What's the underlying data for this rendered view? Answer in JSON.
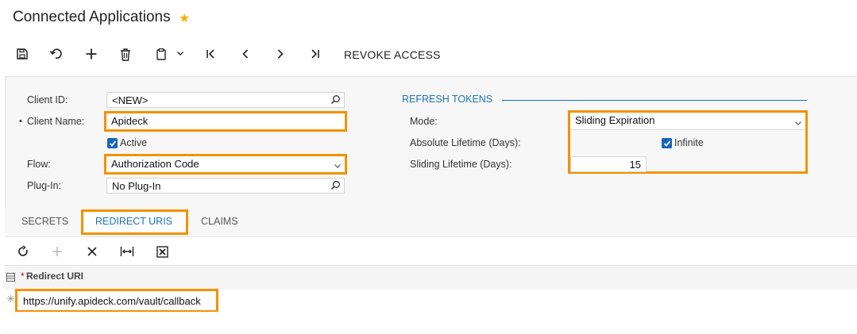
{
  "header": {
    "title": "Connected Applications",
    "star": "★"
  },
  "toolbar": {
    "icons": [
      "save-icon",
      "undo-icon",
      "add-icon",
      "delete-icon",
      "copy-paste-icon",
      "first-record-icon",
      "previous-record-icon",
      "next-record-icon",
      "last-record-icon"
    ],
    "revoke_label": "REVOKE ACCESS"
  },
  "form": {
    "client_id": {
      "label": "Client ID:",
      "value": "<NEW>"
    },
    "client_name": {
      "label": "Client Name:",
      "required_mark": "•",
      "value": "Apideck"
    },
    "active": {
      "label": "Active",
      "checked": true
    },
    "flow": {
      "label": "Flow:",
      "value": "Authorization Code"
    },
    "plugin": {
      "label": "Plug-In:",
      "value": "No Plug-In"
    }
  },
  "refresh_tokens": {
    "header": "REFRESH TOKENS",
    "mode": {
      "label": "Mode:",
      "value": "Sliding Expiration"
    },
    "absolute_lifetime": {
      "label": "Absolute Lifetime (Days):",
      "infinite_label": "Infinite",
      "infinite_checked": true
    },
    "sliding_lifetime": {
      "label": "Sliding Lifetime (Days):",
      "value": "15"
    }
  },
  "tabs": [
    {
      "label": "SECRETS",
      "active": false
    },
    {
      "label": "REDIRECT URIS",
      "active": true
    },
    {
      "label": "CLAIMS",
      "active": false
    }
  ],
  "grid": {
    "toolbar_icons": [
      "refresh-icon",
      "add-row-icon",
      "delete-row-icon",
      "fit-columns-icon",
      "export-excel-icon"
    ],
    "column_header": "Redirect URI",
    "required_mark": "*",
    "rows": [
      {
        "redirect_uri": "https://unify.apideck.com/vault/callback"
      }
    ]
  },
  "colors": {
    "accent": "#1b73b9",
    "highlight": "#f39200",
    "star": "#f2b400",
    "checkbox": "#1565c0"
  }
}
